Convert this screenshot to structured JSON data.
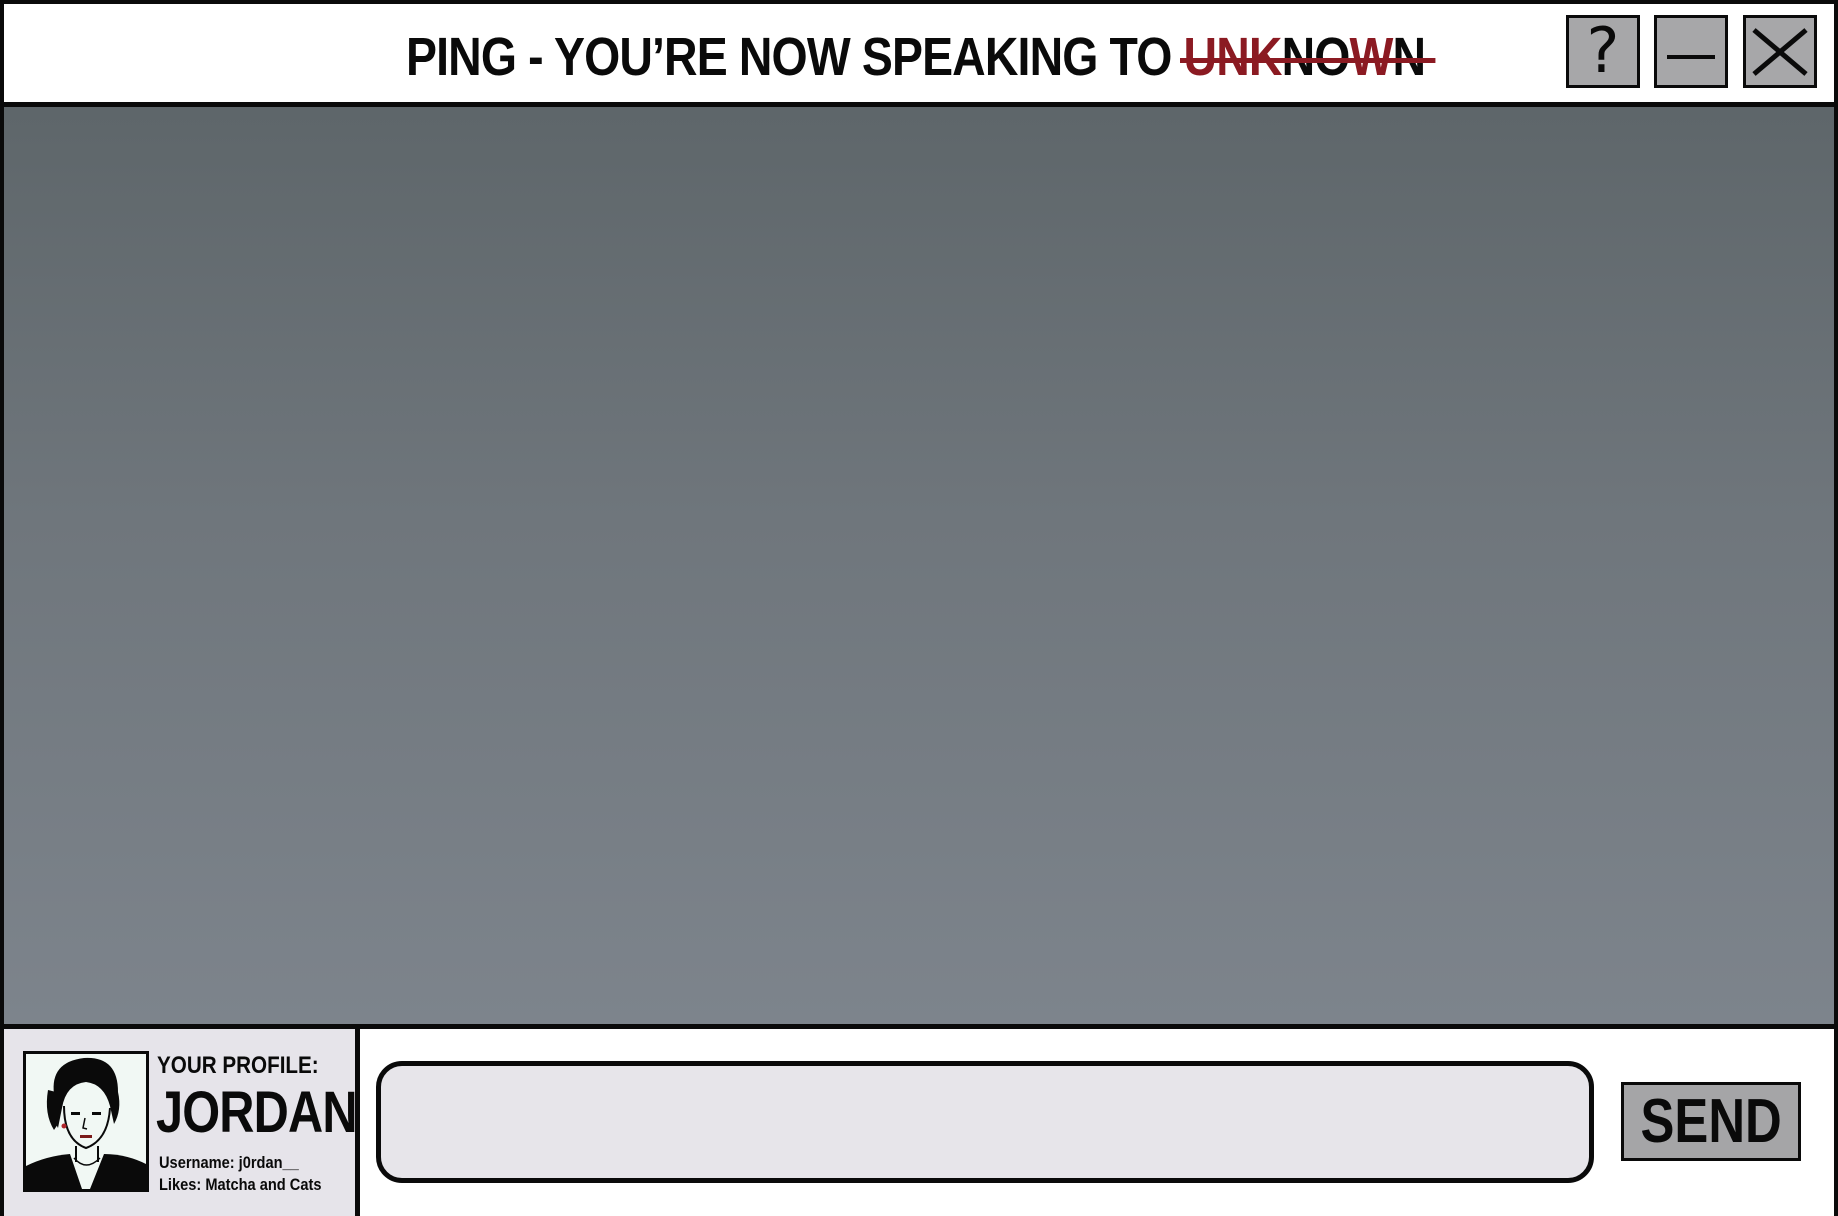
{
  "titlebar": {
    "title_prefix": "PING - YOU’RE NOW SPEAKING TO",
    "struck_name": "UNKNOWN",
    "struck_name_letters": [
      {
        "char": "U",
        "color": "#8b1a22"
      },
      {
        "char": "N",
        "color": "#8b1a22"
      },
      {
        "char": "K",
        "color": "#8b1a22"
      },
      {
        "char": "N",
        "color": "#0a0a0a"
      },
      {
        "char": "O",
        "color": "#0a0a0a"
      },
      {
        "char": "W",
        "color": "#8b1a22"
      },
      {
        "char": "N",
        "color": "#0a0a0a"
      }
    ],
    "help_label": "?",
    "buttons": {
      "help_icon": "question-icon",
      "minimize_icon": "minimize-icon",
      "close_icon": "close-icon"
    }
  },
  "chat": {
    "messages": []
  },
  "profile": {
    "heading": "YOUR PROFILE:",
    "name": "JORDAN",
    "username_line": "Username: j0rdan__",
    "likes_line": "Likes:  Matcha and Cats",
    "avatar_icon": "avatar-portrait"
  },
  "composer": {
    "input_value": "",
    "input_placeholder": "",
    "send_label": "SEND"
  },
  "colors": {
    "accent_red": "#8b1a22",
    "button_gray": "#a5a5a7",
    "chat_bg_top": "#5e666a",
    "chat_bg_bottom": "#7d848c",
    "profile_bg": "#e6e4ea",
    "input_bg": "#e7e5ea"
  }
}
